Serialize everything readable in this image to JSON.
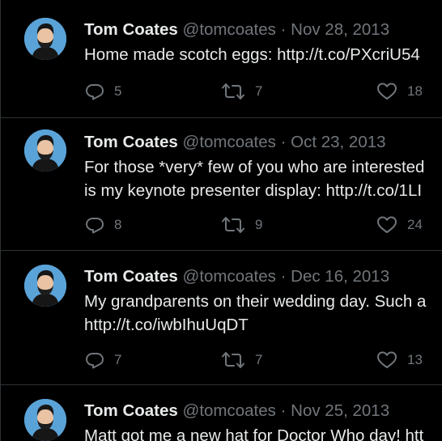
{
  "tweets": [
    {
      "name": "Tom Coates",
      "handle": "@tomcoates",
      "separator": "·",
      "date": "Nov 28, 2013",
      "lines": [
        "Home made scotch eggs: http://t.co/PXcriU54"
      ],
      "replies": "5",
      "retweets": "7",
      "likes": "18"
    },
    {
      "name": "Tom Coates",
      "handle": "@tomcoates",
      "separator": "·",
      "date": "Oct 23, 2013",
      "lines": [
        "For those *very* few of you who are interested",
        "is my keynote presenter display: http://t.co/1LI"
      ],
      "replies": "8",
      "retweets": "9",
      "likes": "24"
    },
    {
      "name": "Tom Coates",
      "handle": "@tomcoates",
      "separator": "·",
      "date": "Dec 16, 2013",
      "lines": [
        "My grandparents on their wedding day. Such a",
        "http://t.co/iwbIhuUqDT"
      ],
      "replies": "7",
      "retweets": "7",
      "likes": "13"
    },
    {
      "name": "Tom Coates",
      "handle": "@tomcoates",
      "separator": "·",
      "date": "Nov 25, 2013",
      "lines": [
        "Matt got me a new hat for Doctor Who day! htt"
      ],
      "replies": "",
      "retweets": "",
      "likes": ""
    }
  ],
  "icons": {
    "reply": "reply-icon",
    "retweet": "retweet-icon",
    "like": "heart-icon",
    "avatar": "avatar"
  },
  "colors": {
    "background": "#000000",
    "primary_text": "#e7e9ea",
    "secondary_text": "#71767b",
    "divider": "#2f3336",
    "avatar_bg": "#5aa3d8"
  }
}
